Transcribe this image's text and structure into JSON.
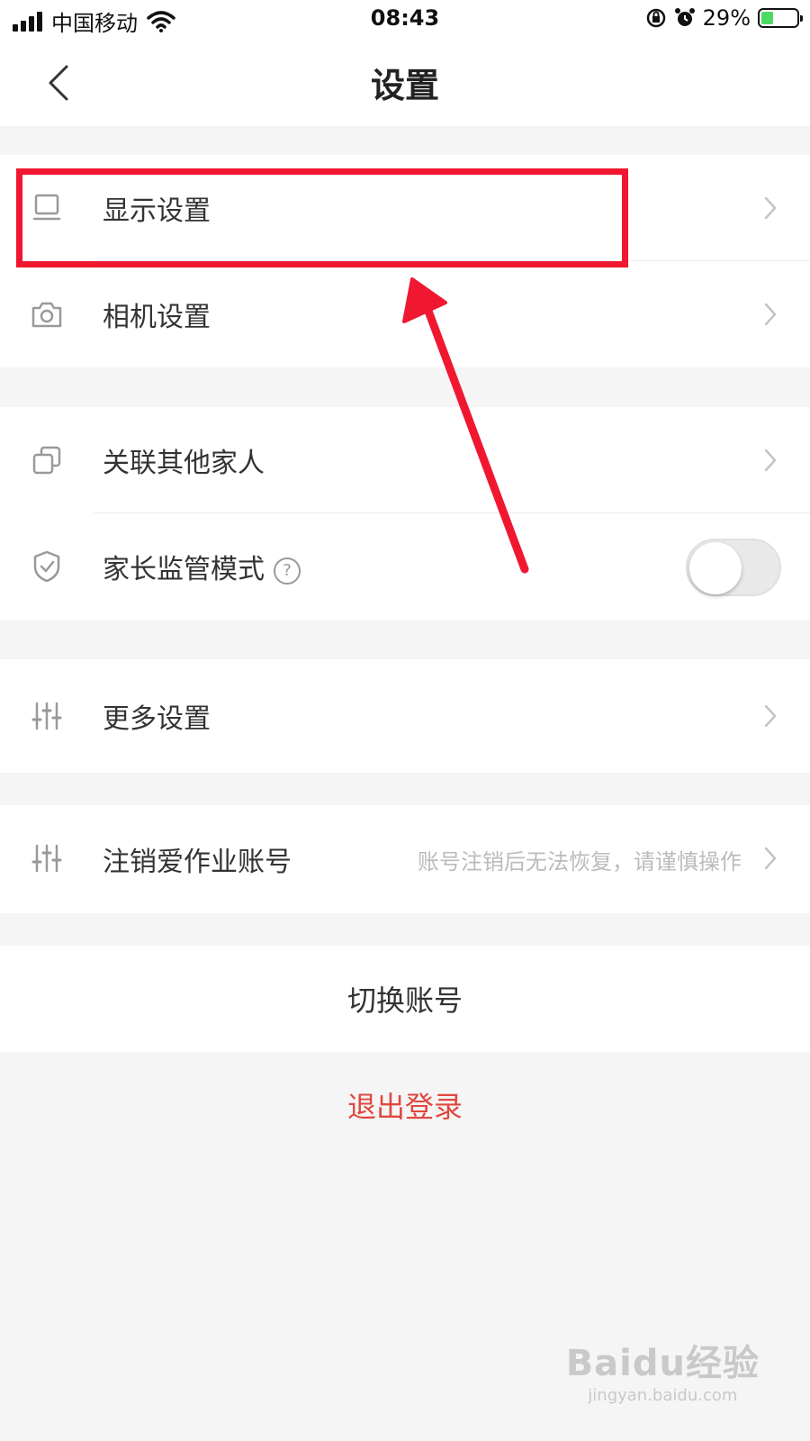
{
  "status_bar": {
    "carrier": "中国移动",
    "time": "08:43",
    "battery_percent": "29%"
  },
  "nav": {
    "title": "设置"
  },
  "groups": [
    {
      "items": [
        {
          "label": "显示设置",
          "icon": "display-icon"
        },
        {
          "label": "相机设置",
          "icon": "camera-icon"
        }
      ]
    },
    {
      "items": [
        {
          "label": "关联其他家人",
          "icon": "link-family-icon"
        },
        {
          "label": "家长监管模式",
          "icon": "shield-icon",
          "help": "?",
          "toggle": false
        }
      ]
    },
    {
      "items": [
        {
          "label": "更多设置",
          "icon": "sliders-icon"
        }
      ]
    },
    {
      "items": [
        {
          "label": "注销爱作业账号",
          "icon": "sliders-icon",
          "hint": "账号注销后无法恢复，请谨慎操作"
        }
      ]
    }
  ],
  "actions": {
    "switch_account": "切换账号",
    "logout": "退出登录"
  },
  "colors": {
    "accent_red": "#e0483f",
    "annotation_red": "#f01831",
    "battery_green": "#4cd964"
  },
  "watermark": {
    "main": "Baidu经验",
    "sub": "jingyan.baidu.com"
  }
}
